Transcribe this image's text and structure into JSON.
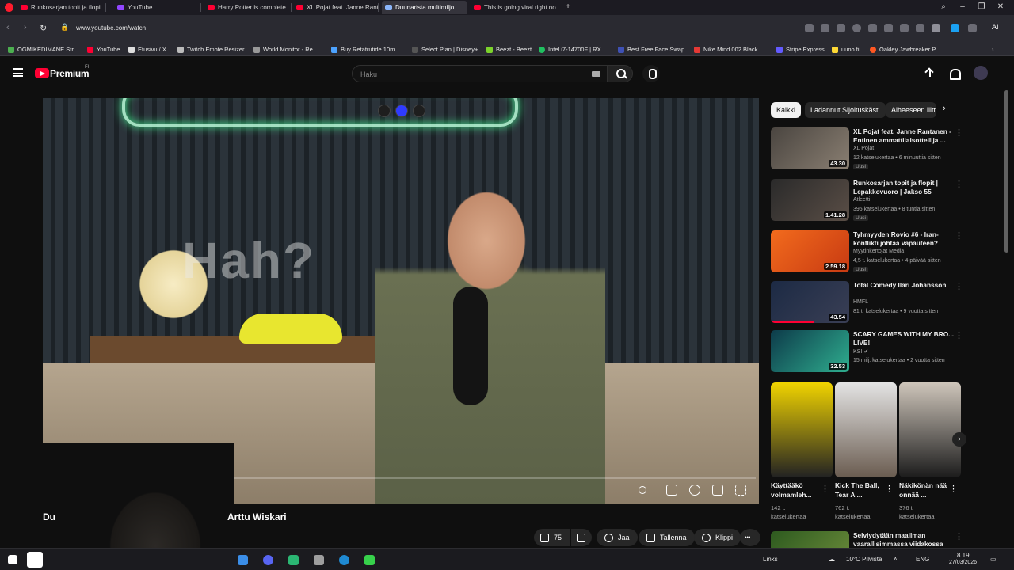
{
  "browser": {
    "tabs": [
      {
        "title": "Runkosarjan topit ja flopit"
      },
      {
        "title": "YouTube"
      },
      {
        "title": "Harry Potter is complete"
      },
      {
        "title": "XL Pojat feat. Janne Rante"
      },
      {
        "title": "Duunarista multimiljo"
      },
      {
        "title": "This is going viral right no"
      }
    ],
    "new_tab": "+",
    "url": "www.youtube.com/watch",
    "ai_label": "AI"
  },
  "bookmarks": [
    {
      "label": "OGMIKEDIMANE Str..."
    },
    {
      "label": "YouTube"
    },
    {
      "label": "Etusivu / X"
    },
    {
      "label": "Twitch Emote Resizer"
    },
    {
      "label": "World Monitor - Re..."
    },
    {
      "label": "Buy Retatrutide 10m..."
    },
    {
      "label": "Select Plan | Disney+"
    },
    {
      "label": "Beezt - Beezt"
    },
    {
      "label": "Intel i7-14700F | RX..."
    },
    {
      "label": "Best Free Face Swap..."
    },
    {
      "label": "Nike Mind 002 Black..."
    },
    {
      "label": "Stripe Express"
    },
    {
      "label": "uuno.fi"
    },
    {
      "label": "Oakley Jawbreaker P..."
    }
  ],
  "youtube": {
    "logo_text": "Premium",
    "country_code": "FI",
    "search_placeholder": "Haku"
  },
  "player": {
    "overlay_text": "Hah?",
    "progress_fraction": 0.01,
    "title_fragment": "Du",
    "channel": "Arttu Wiskari",
    "play_glyph": "II"
  },
  "actions": {
    "likes": "75",
    "share": "Jaa",
    "save": "Tallenna",
    "clip": "Klippi",
    "more": "•••"
  },
  "chips": [
    {
      "label": "Kaikki",
      "selected": true
    },
    {
      "label": "Ladannut Sijoituskästi",
      "selected": false
    },
    {
      "label": "Aiheeseen liitt",
      "selected": false
    }
  ],
  "recommendations": [
    {
      "title": "XL Pojat feat. Janne Rantanen - Entinen ammattilaisotteilija ...",
      "channel": "XL Pojat",
      "meta": "12 katselukertaa • 6 minuuttia sitten",
      "duration": "43.30",
      "badge": "Uusi"
    },
    {
      "title": "Runkosarjan topit ja flopit | Lepakkovuoro | Jakso 55",
      "channel": "Atleetti",
      "meta": "395 katselukertaa • 8 tuntia sitten",
      "duration": "1.41.28",
      "badge": "Uusi"
    },
    {
      "title": "Tyhmyyden Rovio #6 - Iran-konflikti johtaa vapauteen?",
      "channel": "Myytinkertojat Media",
      "meta": "4,5 t. katselukertaa • 4 päivää sitten",
      "duration": "2.59.18",
      "badge": "Uusi"
    },
    {
      "title": "Total Comedy Ilari Johansson",
      "channel": "HMFL",
      "meta": "81 t. katselukertaa • 9 vuotta sitten",
      "duration": "43.54",
      "badge": ""
    },
    {
      "title": "SCARY GAMES WITH MY BRO... LIVE!",
      "channel": "KSI",
      "meta": "15 milj. katselukertaa • 2 vuotta sitten",
      "duration": "32.53",
      "badge": ""
    }
  ],
  "shorts": [
    {
      "title": "Käyttääkö volmamleh...",
      "views": "142 t. katselukertaa"
    },
    {
      "title": "Kick The Ball, Tear A ...",
      "views": "762 t. katselukertaa"
    },
    {
      "title": "Näkikönän nää onnää ...",
      "views": "376 t. katselukertaa"
    }
  ],
  "partial_rec": {
    "title": "Selviydytään maailman vaarallisimmassa viidakossa"
  },
  "taskbar": {
    "links": "Links",
    "weather": "10°C Pilvistä",
    "lang": "ENG",
    "time": "8.19",
    "date": "27/03/2026"
  },
  "colors": {
    "accent": "#ff0033",
    "background": "#0f0f0f",
    "chip_selected": "#f1f1f1"
  }
}
